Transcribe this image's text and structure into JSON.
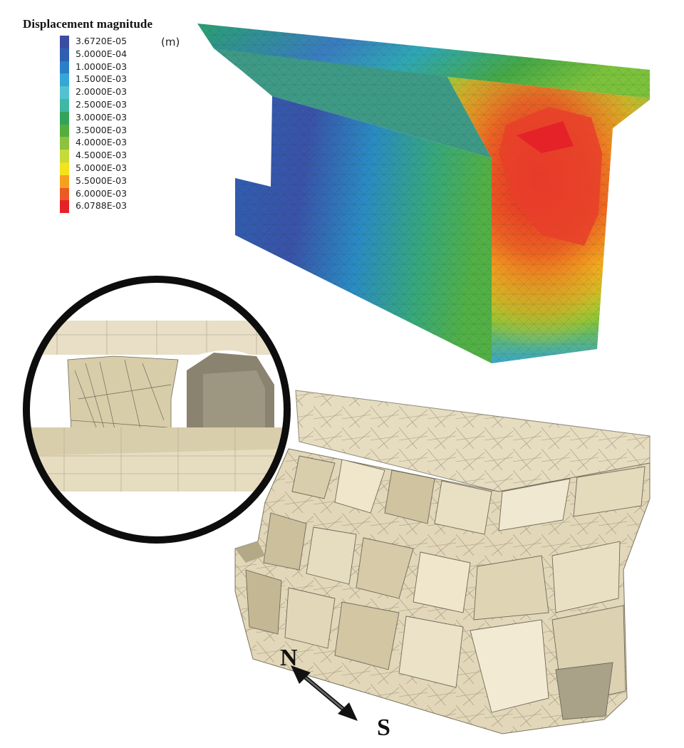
{
  "legend": {
    "title": "Displacement magnitude",
    "unit": "(m)",
    "entries": [
      {
        "label": "3.6720E-05",
        "color": "#3a4da0"
      },
      {
        "label": "5.0000E-04",
        "color": "#2f5fb3"
      },
      {
        "label": "1.0000E-03",
        "color": "#2a7fc8"
      },
      {
        "label": "1.5000E-03",
        "color": "#35a6d6"
      },
      {
        "label": "2.0000E-03",
        "color": "#53c1cf"
      },
      {
        "label": "2.5000E-03",
        "color": "#3fb7a3"
      },
      {
        "label": "3.0000E-03",
        "color": "#33a35b"
      },
      {
        "label": "3.5000E-03",
        "color": "#54ad3c"
      },
      {
        "label": "4.0000E-03",
        "color": "#8cc23e"
      },
      {
        "label": "4.5000E-03",
        "color": "#c6da3a"
      },
      {
        "label": "5.0000E-03",
        "color": "#f2e31c"
      },
      {
        "label": "5.5000E-03",
        "color": "#f4a11f"
      },
      {
        "label": "6.0000E-03",
        "color": "#ec5a24"
      },
      {
        "label": "6.0788E-03",
        "color": "#e42228"
      }
    ]
  },
  "compass": {
    "north_label": "N",
    "south_label": "S"
  },
  "colors": {
    "rock": "#e6dcc0",
    "rock_dark": "#c9bd9b",
    "rock_shadow": "#8a836f",
    "mesh_line": "#8f8a7a",
    "inset_border": "#0d0d0d"
  }
}
